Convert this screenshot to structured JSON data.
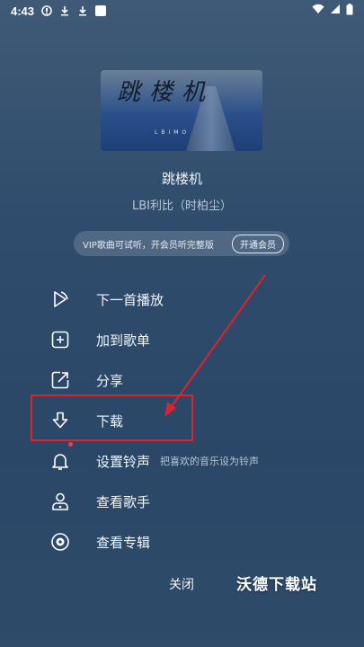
{
  "status_bar": {
    "time": "4:43",
    "icons_left": [
      "notification-icon",
      "download-icon",
      "download-icon",
      "app-icon"
    ],
    "icons_right": [
      "wifi-icon",
      "signal-icon",
      "battery-icon"
    ]
  },
  "album": {
    "art_text": "跳楼机",
    "art_sub": "LBIMO"
  },
  "song": {
    "title": "跳楼机",
    "artist": "LBI利比（时柏尘）"
  },
  "vip": {
    "text": "VIP歌曲可试听，开会员听完整版",
    "button": "开通会员"
  },
  "menu": [
    {
      "label": "下一首播放",
      "icon": "play-next-icon"
    },
    {
      "label": "加到歌单",
      "icon": "add-to-playlist-icon"
    },
    {
      "label": "分享",
      "icon": "share-icon"
    },
    {
      "label": "下载",
      "icon": "download-icon"
    },
    {
      "label": "设置铃声",
      "icon": "bell-icon",
      "hint": "把喜欢的音乐设为铃声"
    },
    {
      "label": "查看歌手",
      "icon": "singer-icon"
    },
    {
      "label": "查看专辑",
      "icon": "album-icon"
    }
  ],
  "close_label": "关闭",
  "watermark": "沃德下载站",
  "colors": {
    "highlight": "#e0232a",
    "background": "#2f4c6c"
  }
}
